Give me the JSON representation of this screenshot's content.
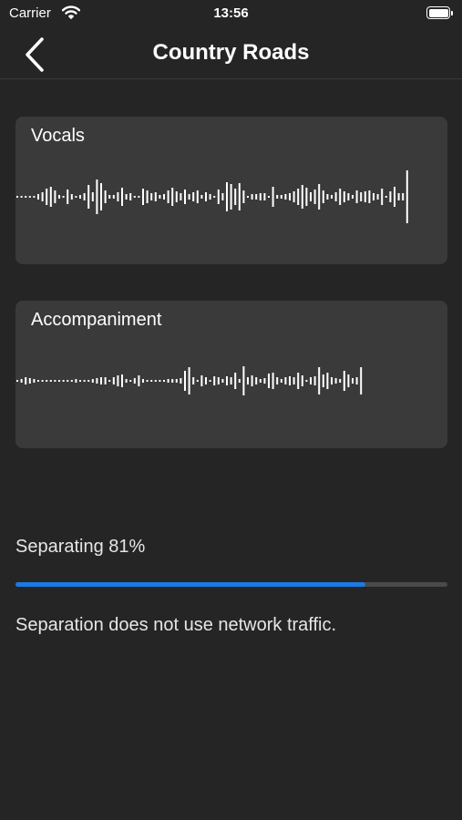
{
  "status_bar": {
    "carrier": "Carrier",
    "time": "13:56",
    "wifi_icon": "wifi-icon",
    "battery_icon": "battery-icon"
  },
  "nav": {
    "title": "Country Roads",
    "back_icon": "chevron-left-icon"
  },
  "tracks": [
    {
      "title": "Vocals"
    },
    {
      "title": "Accompaniment"
    }
  ],
  "progress": {
    "label": "Separating 81%",
    "value": 0.81,
    "bar_color": "#1a7ae6"
  },
  "info": {
    "text": "Separation does not use network traffic."
  },
  "colors": {
    "background": "#252525",
    "card": "#3a3a3a",
    "accent": "#1a7ae6"
  }
}
